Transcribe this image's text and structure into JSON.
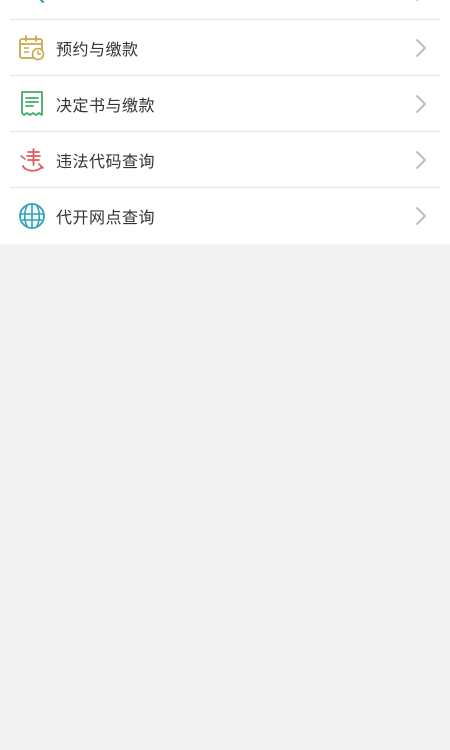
{
  "menu": {
    "items": [
      {
        "label": "",
        "icon": "search-icon",
        "color": "#2aa3b8"
      },
      {
        "label": "预约与缴款",
        "icon": "calendar-clock-icon",
        "color": "#c8a84a"
      },
      {
        "label": "决定书与缴款",
        "icon": "receipt-icon",
        "color": "#3fae6a"
      },
      {
        "label": "违法代码查询",
        "icon": "violation-icon",
        "color": "#e05b5b"
      },
      {
        "label": "代开网点查询",
        "icon": "globe-icon",
        "color": "#2aa3b8"
      }
    ]
  }
}
